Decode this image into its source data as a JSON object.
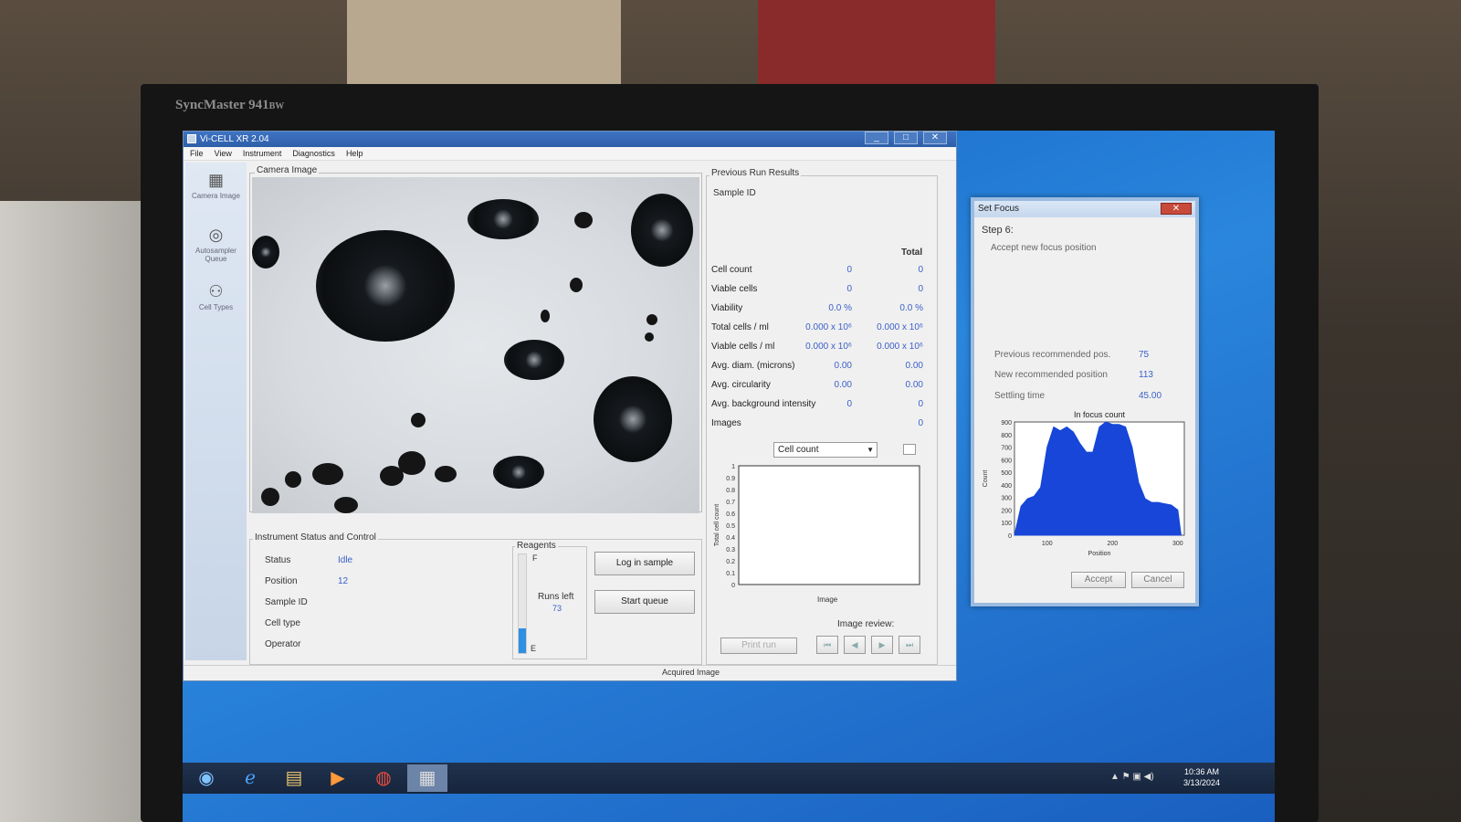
{
  "monitor": {
    "brand": "SyncMaster",
    "model": "941",
    "suffix": "BW"
  },
  "window": {
    "title": "Vi-CELL XR 2.04",
    "minimize": "_",
    "maximize": "□",
    "close": "✕"
  },
  "menu": [
    "File",
    "View",
    "Instrument",
    "Diagnostics",
    "Help"
  ],
  "sidebar": [
    {
      "label": "Camera Image",
      "icon": "camera-icon"
    },
    {
      "label": "Autosampler Queue",
      "icon": "carousel-icon"
    },
    {
      "label": "Cell Types",
      "icon": "cells-icon"
    }
  ],
  "camera_image": {
    "label": "Camera Image"
  },
  "instrument_status": {
    "title": "Instrument Status and Control",
    "fields": [
      {
        "label": "Status",
        "value": "Idle"
      },
      {
        "label": "Position",
        "value": "12"
      },
      {
        "label": "Sample ID",
        "value": ""
      },
      {
        "label": "Cell type",
        "value": ""
      },
      {
        "label": "Operator",
        "value": ""
      }
    ],
    "reagents": {
      "title": "Reagents",
      "full": "F",
      "empty": "E",
      "runs_left_label": "Runs left",
      "runs_left_value": "73",
      "level": 0.25
    },
    "log_in_sample": "Log in sample",
    "start_queue": "Start queue"
  },
  "previous_run": {
    "title": "Previous Run Results",
    "sample_id_label": "Sample ID",
    "total_header": "Total",
    "rows": [
      {
        "label": "Cell count",
        "v1": "0",
        "v2": "0"
      },
      {
        "label": "Viable cells",
        "v1": "0",
        "v2": "0"
      },
      {
        "label": "Viability",
        "v1": "0.0 %",
        "v2": "0.0 %"
      },
      {
        "label": "Total cells / ml",
        "v1": "0.000  x 10⁶",
        "v2": "0.000  x 10⁶"
      },
      {
        "label": "Viable cells / ml",
        "v1": "0.000  x 10⁶",
        "v2": "0.000  x 10⁶"
      },
      {
        "label": "Avg. diam. (microns)",
        "v1": "0.00",
        "v2": "0.00"
      },
      {
        "label": "Avg. circularity",
        "v1": "0.00",
        "v2": "0.00"
      },
      {
        "label": "Avg. background intensity",
        "v1": "0",
        "v2": "0"
      },
      {
        "label": "Images",
        "v1": "",
        "v2": "0"
      }
    ],
    "dropdown_value": "Cell count",
    "chart": {
      "ylabel": "Total cell count",
      "xlabel": "Image",
      "yticks": [
        "0",
        "0.1",
        "0.2",
        "0.3",
        "0.4",
        "0.5",
        "0.6",
        "0.7",
        "0.8",
        "0.9",
        "1"
      ]
    },
    "print_run": "Print run",
    "image_review": "Image review:"
  },
  "acquired_image": "Acquired Image",
  "set_focus": {
    "title": "Set Focus",
    "close": "✕",
    "step": "Step 6:",
    "instruction": "Accept new focus position",
    "rows": [
      {
        "label": "Previous recommended pos.",
        "value": "75"
      },
      {
        "label": "New recommended position",
        "value": "113"
      },
      {
        "label": "Settling time",
        "value": "45.00"
      }
    ],
    "accept": "Accept",
    "cancel": "Cancel"
  },
  "chart_data": {
    "type": "area",
    "title": "In focus count",
    "xlabel": "Position",
    "ylabel": "Count",
    "xlim": [
      50,
      310
    ],
    "ylim": [
      0,
      900
    ],
    "xticks": [
      100,
      200,
      300
    ],
    "yticks": [
      0,
      100,
      200,
      300,
      400,
      500,
      600,
      700,
      800,
      900
    ],
    "x": [
      50,
      60,
      70,
      80,
      90,
      100,
      110,
      120,
      130,
      140,
      150,
      160,
      170,
      180,
      190,
      200,
      210,
      220,
      230,
      240,
      250,
      260,
      270,
      280,
      290,
      300,
      305
    ],
    "values": [
      0,
      230,
      290,
      310,
      380,
      700,
      860,
      830,
      860,
      820,
      730,
      660,
      660,
      860,
      900,
      880,
      880,
      860,
      700,
      420,
      290,
      260,
      260,
      250,
      240,
      200,
      0
    ],
    "color": "#1746d8"
  },
  "taskbar": {
    "items": [
      "start-orb-icon",
      "internet-explorer-icon",
      "file-explorer-icon",
      "media-player-icon",
      "chrome-icon",
      "vicell-app-icon"
    ],
    "time": "10:36 AM",
    "date": "3/13/2024"
  }
}
